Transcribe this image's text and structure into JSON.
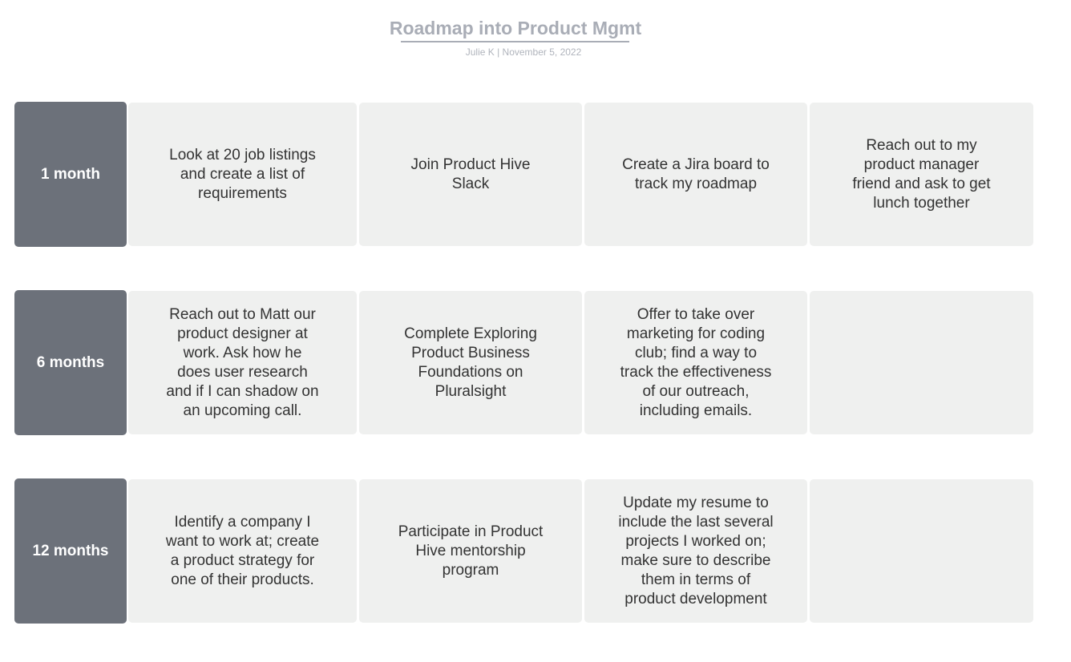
{
  "header": {
    "title": "Roadmap into Product Mgmt",
    "subtitle": "Julie K  |  November 5, 2022"
  },
  "rows": [
    {
      "label": "1 month",
      "items": [
        "Look at 20 job listings\nand create a list of\nrequirements",
        "Join Product Hive\nSlack",
        "Create a Jira board to\ntrack my roadmap",
        "Reach out to my\nproduct manager\nfriend and ask to get\nlunch together"
      ]
    },
    {
      "label": "6 months",
      "items": [
        "Reach out to Matt our\nproduct designer at\nwork. Ask how he\ndoes user research\nand if I can shadow on\nan upcoming call.",
        "Complete Exploring\nProduct Business\nFoundations on\nPluralsight",
        "Offer to take over\nmarketing for coding\nclub; find a way to\ntrack the effectiveness\nof our outreach,\nincluding emails.",
        ""
      ]
    },
    {
      "label": "12 months",
      "items": [
        "Identify a company I\nwant to work at; create\na product strategy for\none of their products.",
        "Participate in Product\nHive mentorship\nprogram",
        "Update my resume to\ninclude the last several\nprojects I worked on;\nmake sure to describe\nthem in terms of\nproduct development",
        ""
      ]
    }
  ]
}
